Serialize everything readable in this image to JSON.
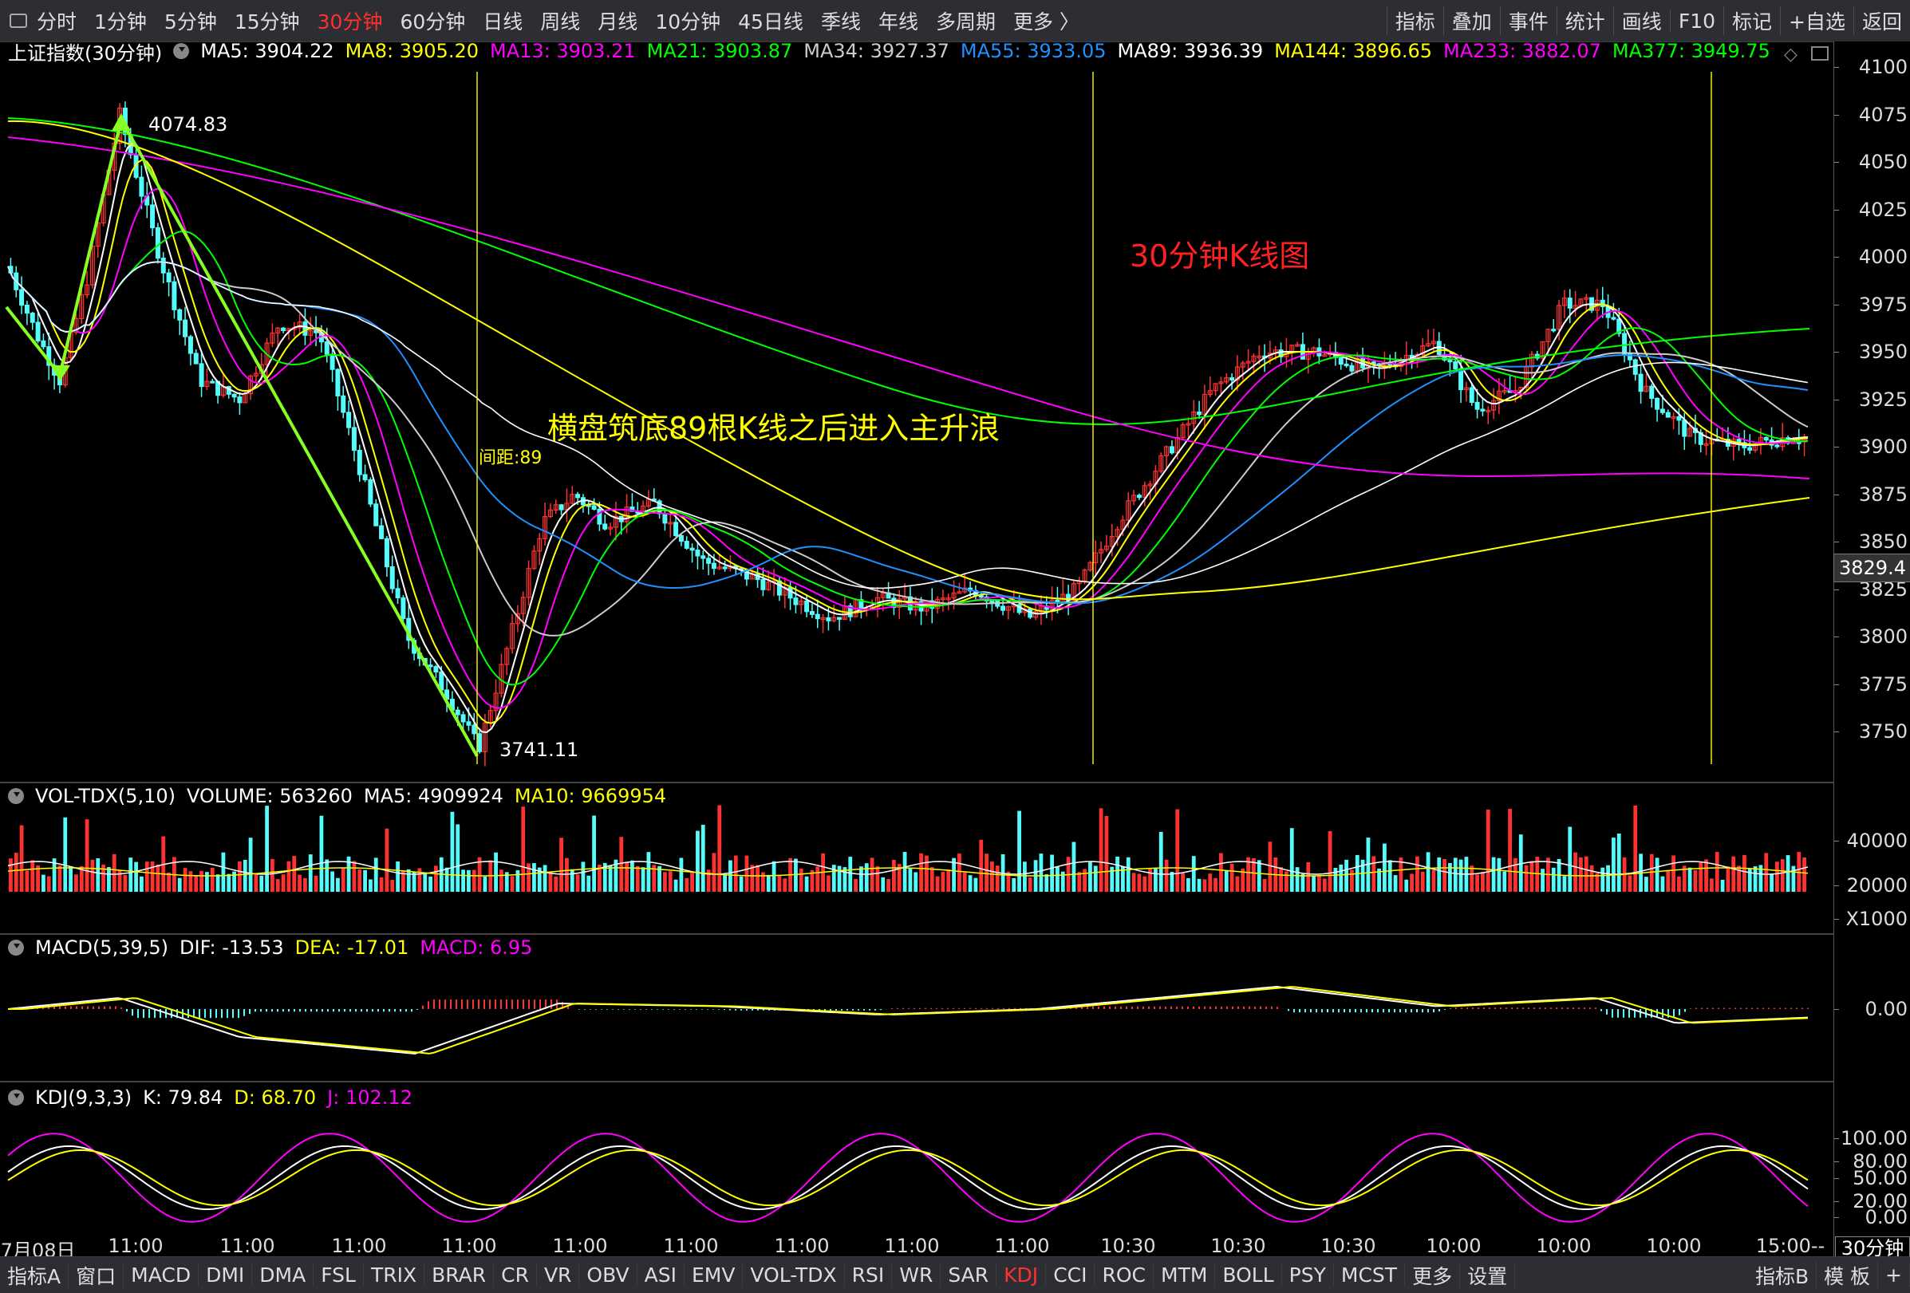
{
  "toolbar": {
    "periods": [
      "分时",
      "1分钟",
      "5分钟",
      "15分钟",
      "30分钟",
      "60分钟",
      "日线",
      "周线",
      "月线",
      "10分钟",
      "45日线",
      "季线",
      "年线",
      "多周期",
      "更多 〉"
    ],
    "active_period": "30分钟",
    "tools": [
      "指标",
      "叠加",
      "事件",
      "统计",
      "画线",
      "F10",
      "标记",
      "+自选",
      "返回"
    ]
  },
  "main_chart": {
    "title": "上证指数(30分钟)",
    "ma": [
      {
        "label": "MA5: 3904.22",
        "color": "#ffffff"
      },
      {
        "label": "MA8: 3905.20",
        "color": "#ffff00"
      },
      {
        "label": "MA13: 3903.21",
        "color": "#ff00ff"
      },
      {
        "label": "MA21: 3903.87",
        "color": "#00ff00"
      },
      {
        "label": "MA34: 3927.37",
        "color": "#cccccc"
      },
      {
        "label": "MA55: 3933.05",
        "color": "#1e90ff"
      },
      {
        "label": "MA89: 3936.39",
        "color": "#ffffff"
      },
      {
        "label": "MA144: 3896.65",
        "color": "#ffff00"
      },
      {
        "label": "MA233: 3882.07",
        "color": "#ff00ff"
      },
      {
        "label": "MA377: 3949.75",
        "color": "#00ff00"
      }
    ],
    "y_ticks": [
      "4100",
      "4075",
      "4050",
      "4025",
      "4000",
      "3975",
      "3950",
      "3925",
      "3900",
      "3875",
      "3850",
      "3825",
      "3800",
      "3775",
      "3750"
    ],
    "current_price": "3829.4",
    "high_label": "4074.83",
    "low_label": "3741.11",
    "interval_label": "间距:89",
    "annotation_title": "30分钟K线图",
    "annotation_text": "横盘筑底89根K线之后进入主升浪"
  },
  "volume_panel": {
    "title": "VOL-TDX(5,10)",
    "volume": "VOLUME: 563260",
    "ma5": "MA5: 4909924",
    "ma10": "MA10: 9669954",
    "y_ticks": [
      "40000",
      "20000"
    ],
    "unit": "X1000"
  },
  "macd_panel": {
    "title": "MACD(5,39,5)",
    "dif": "DIF: -13.53",
    "dea": "DEA: -17.01",
    "macd": "MACD: 6.95",
    "y_ticks": [
      "0.00"
    ]
  },
  "kdj_panel": {
    "title": "KDJ(9,3,3)",
    "k": "K: 79.84",
    "d": "D: 68.70",
    "j": "J: 102.12",
    "y_ticks": [
      "100.00",
      "80.00",
      "50.00",
      "20.00",
      "0.00"
    ]
  },
  "x_axis": {
    "labels": [
      "07月08日",
      "11:00",
      "11:00",
      "11:00",
      "11:00",
      "11:00",
      "11:00",
      "11:00",
      "11:00",
      "11:00",
      "10:30",
      "10:30",
      "10:30",
      "10:00",
      "10:00",
      "10:00",
      "15:00--"
    ],
    "period_box": "30分钟"
  },
  "bottom_tabs": {
    "items": [
      "指标A",
      "窗口",
      "MACD",
      "DMI",
      "DMA",
      "FSL",
      "TRIX",
      "BRAR",
      "CR",
      "VR",
      "OBV",
      "ASI",
      "EMV",
      "VOL-TDX",
      "RSI",
      "WR",
      "SAR",
      "KDJ",
      "CCI",
      "ROC",
      "MTM",
      "BOLL",
      "PSY",
      "MCST",
      "更多",
      "设置"
    ],
    "active": "KDJ",
    "right": [
      "指标B",
      "模 板",
      "+"
    ]
  },
  "colors": {
    "up": "#ff3232",
    "down": "#54fcfc",
    "ma_yellow": "#ffff00",
    "ma_magenta": "#ff00ff",
    "ma_green": "#00ff00",
    "ma_blue": "#1e90ff"
  }
}
